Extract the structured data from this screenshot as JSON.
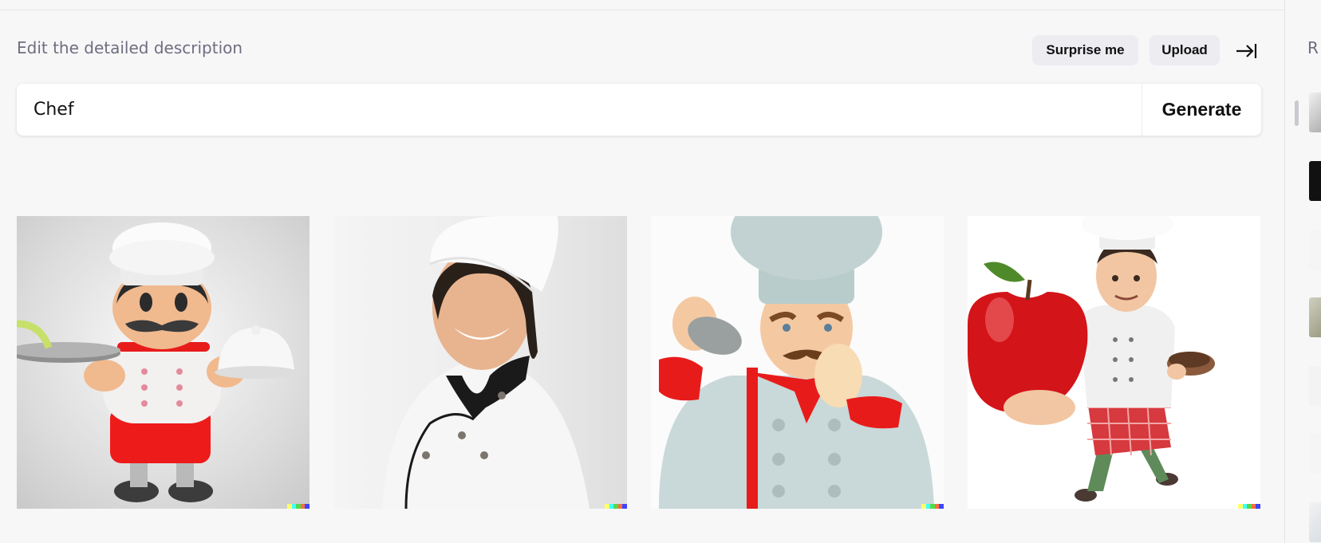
{
  "editor": {
    "heading": "Edit the detailed description",
    "surprise_label": "Surprise me",
    "upload_label": "Upload",
    "prompt_value": "Chef",
    "generate_label": "Generate"
  },
  "results": [
    {
      "description": "cartoon chef holding tray and cloche"
    },
    {
      "description": "smiling chef in white coat and hat"
    },
    {
      "description": "cartoon chef with mustache"
    },
    {
      "description": "cartoon chef holding giant red apple"
    }
  ],
  "watermark_colors": [
    "#ffff66",
    "#42ffff",
    "#51da4c",
    "#ff6e3c",
    "#3c46ff"
  ],
  "sidebar": {
    "label": "R"
  },
  "icons": {
    "collapse": "arrow-right-to-bar-icon"
  }
}
